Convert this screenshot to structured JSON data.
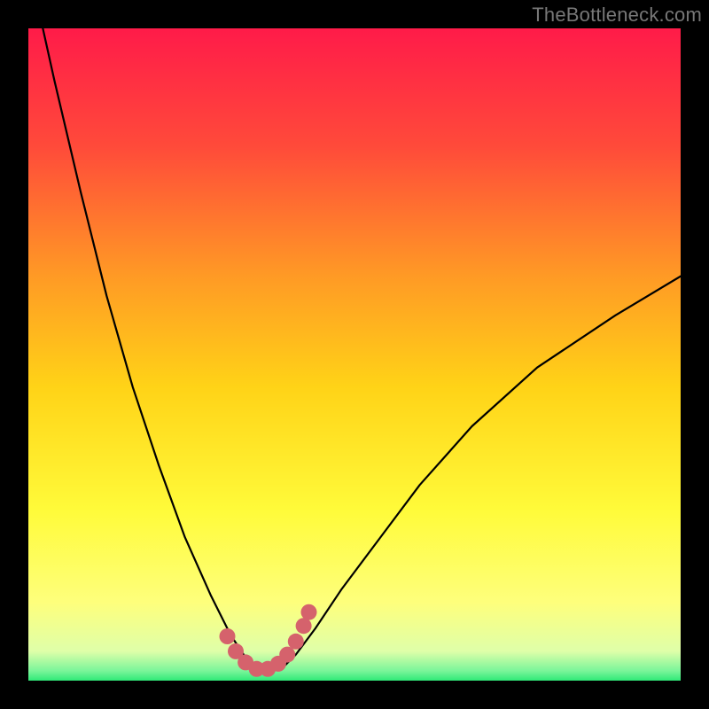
{
  "watermark": "TheBottleneck.com",
  "colors": {
    "frame": "#000000",
    "grad_top": "#ff1b49",
    "grad_upper_mid": "#ff7a2e",
    "grad_mid": "#ffd317",
    "grad_lower_mid": "#fffb3a",
    "grad_bottom_yellow": "#feff7c",
    "grad_bottom_green": "#2fe977",
    "curve_stroke": "#000000",
    "marker_fill": "#d5626c"
  },
  "chart_data": {
    "type": "line",
    "title": "",
    "xlabel": "",
    "ylabel": "",
    "xlim": [
      0,
      100
    ],
    "ylim": [
      0,
      100
    ],
    "series": [
      {
        "name": "bottleneck-curve",
        "x": [
          0,
          4,
          8,
          12,
          16,
          20,
          24,
          28,
          31,
          33,
          35,
          37,
          39,
          41,
          44,
          48,
          54,
          60,
          68,
          78,
          90,
          100
        ],
        "y": [
          110,
          92,
          75,
          59,
          45,
          33,
          22,
          13,
          7,
          4,
          2,
          1.5,
          2,
          4,
          8,
          14,
          22,
          30,
          39,
          48,
          56,
          62
        ]
      }
    ],
    "markers": {
      "name": "highlight-dots",
      "x": [
        30.5,
        31.8,
        33.3,
        35.0,
        36.7,
        38.3,
        39.7,
        41.0,
        42.2,
        43.0
      ],
      "y": [
        6.8,
        4.5,
        2.8,
        1.8,
        1.8,
        2.6,
        4.0,
        6.0,
        8.4,
        10.5
      ]
    }
  }
}
